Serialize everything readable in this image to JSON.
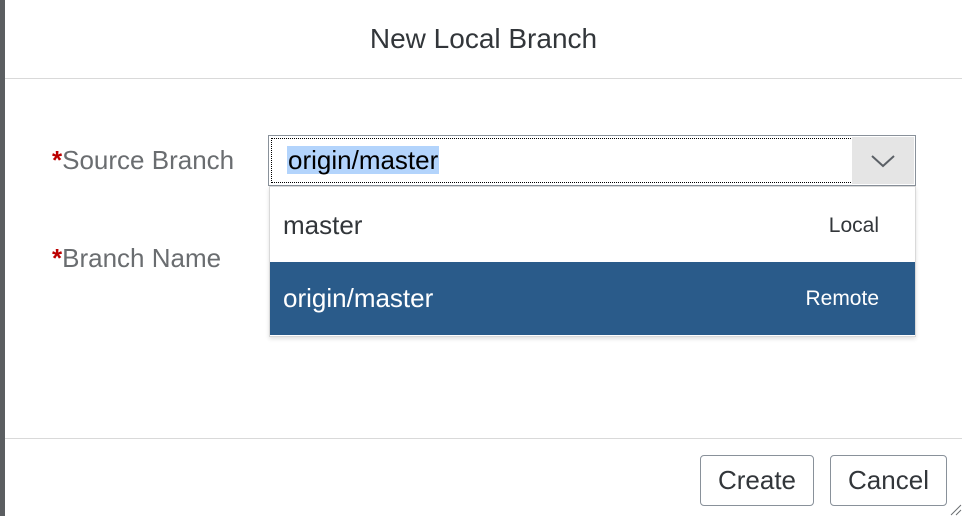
{
  "dialog": {
    "title": "New Local Branch"
  },
  "form": {
    "required_marker": "*",
    "source_branch_label": "Source Branch",
    "branch_name_label": "Branch Name",
    "source_branch_value": "origin/master",
    "arrow_icon": "chevron-down-icon"
  },
  "dropdown": {
    "options": [
      {
        "text": "master",
        "info": "Local",
        "selected": false
      },
      {
        "text": "origin/master",
        "info": "Remote",
        "selected": true
      }
    ],
    "selected_color": "#2a5b8a"
  },
  "footer": {
    "create_label": "Create",
    "cancel_label": "Cancel"
  }
}
